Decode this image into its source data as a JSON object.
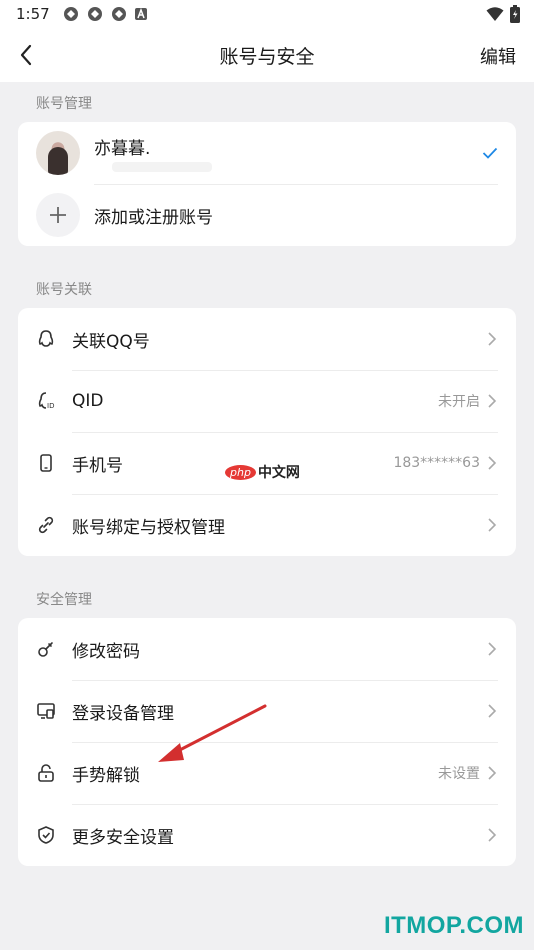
{
  "status_bar": {
    "time": "1:57"
  },
  "nav": {
    "title": "账号与安全",
    "edit_label": "编辑"
  },
  "sections": {
    "account_mgmt": {
      "label": "账号管理",
      "account_name": "亦暮暮.",
      "add_label": "添加或注册账号"
    },
    "account_link": {
      "label": "账号关联",
      "items": [
        {
          "label": "关联QQ号",
          "value": ""
        },
        {
          "label": "QID",
          "value": "未开启"
        },
        {
          "label": "手机号",
          "value": "183******63"
        },
        {
          "label": "账号绑定与授权管理",
          "value": ""
        }
      ]
    },
    "security": {
      "label": "安全管理",
      "items": [
        {
          "label": "修改密码",
          "value": ""
        },
        {
          "label": "登录设备管理",
          "value": ""
        },
        {
          "label": "手势解锁",
          "value": "未设置"
        },
        {
          "label": "更多安全设置",
          "value": ""
        }
      ]
    }
  },
  "watermarks": {
    "php_logo": "php",
    "php_text": "中文网",
    "brand": "ITMOP.COM"
  },
  "colors": {
    "accent": "#1e88e5",
    "annotation_arrow": "#d32f2f",
    "brand": "#12a6a0"
  }
}
